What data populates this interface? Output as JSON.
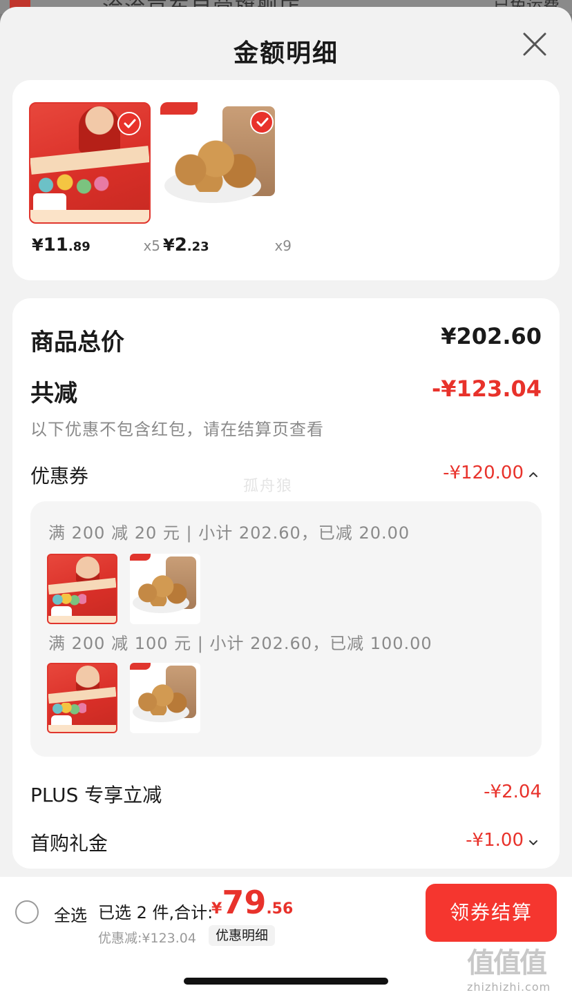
{
  "underlay": {
    "store_name": "洽洽京东自营旗舰店",
    "shipping": "已免运费"
  },
  "sheet": {
    "title": "金额明细"
  },
  "products": [
    {
      "price_yen": "¥",
      "price_int": "11",
      "price_dec": ".89",
      "quantity": "x5"
    },
    {
      "price_yen": "¥",
      "price_int": "2",
      "price_dec": ".23",
      "quantity": "x9"
    }
  ],
  "summary": {
    "total_label": "商品总价",
    "total_value": "¥202.60",
    "reduce_label": "共减",
    "reduce_value": "-¥123.04",
    "note": "以下优惠不包含红包，请在结算页查看",
    "coupon_label": "优惠券",
    "coupon_value": "-¥120.00",
    "watermark": "孤舟狼",
    "coupons": [
      {
        "text": "满 200 减 20 元 | 小计 202.60，已减 20.00"
      },
      {
        "text": "满 200 减 100 元 | 小计 202.60，已减 100.00"
      }
    ],
    "plus_label": "PLUS 专享立减",
    "plus_value": "-¥2.04",
    "gift_label": "首购礼金",
    "gift_value": "-¥1.00"
  },
  "footer": {
    "select_all": "全选",
    "selected_text": "已选 2 件,合计:",
    "total_yen": "¥",
    "total_int": "79",
    "total_dec": ".56",
    "discount_text": "优惠减:¥123.04",
    "detail_chip": "优惠明细",
    "checkout": "领券结算"
  },
  "site_mark": {
    "logo": "值值值",
    "domain": "zhizhizhi.com"
  },
  "colors": {
    "accent_red": "#e8322b",
    "button_red": "#f5362f",
    "sheet_bg": "#f2f2f2",
    "card_bg": "#ffffff"
  }
}
